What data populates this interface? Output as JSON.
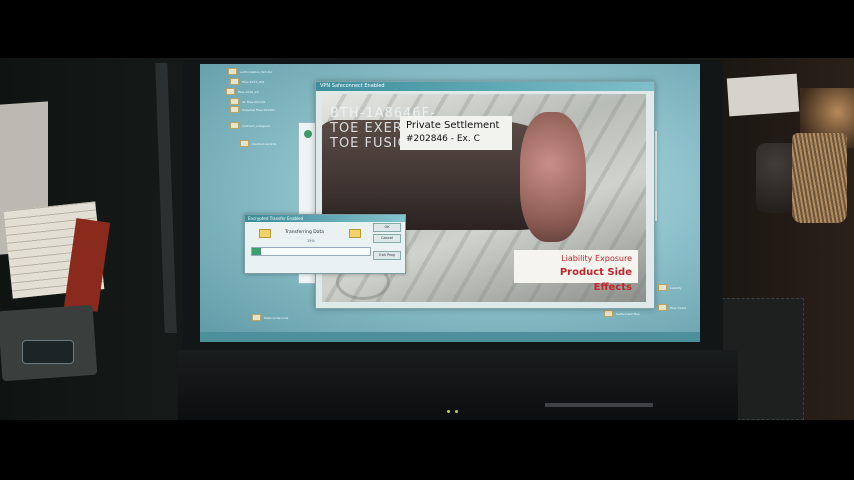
{
  "desktop": {
    "icons": [
      "authorization_fed.doc",
      "Files 2017_001",
      "Files 2016_2A",
      "01 Files 001701",
      "V2Jacket Files 001007",
      "contract_unsigned",
      "medical-records"
    ],
    "right_icons": [
      "Liability",
      "Files folder"
    ],
    "bottom_icons": [
      "Settlement files",
      "Medical Records"
    ]
  },
  "vpn_window": {
    "title": "VPN Safeconnect Enabled",
    "overlay_left": "BTH-1A8646F-\nTOE EXERC\nTOE FUSIO",
    "settlement_line1": "Private Settlement",
    "settlement_line2": "#202846 - Ex. C",
    "liability_line1": "Liability Exposure",
    "liability_line2": "Product Side Effects"
  },
  "transfer_dialog": {
    "title": "Encrypted Transfer Enabled",
    "status": "Transferring Data",
    "percent_label": "15%",
    "progress": 0.08,
    "buttons": [
      "OK",
      "Cancel",
      "Exit Prog"
    ]
  },
  "colors": {
    "desktop": "#8fc2cb",
    "titlebar": "#3e8e9e",
    "accent_red": "#c0262c",
    "progress": "#3c9f6e"
  }
}
